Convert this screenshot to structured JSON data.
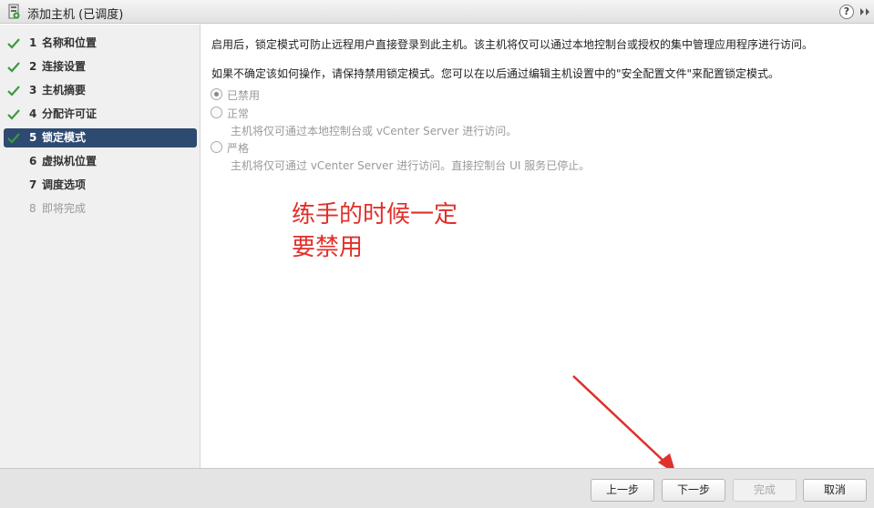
{
  "window": {
    "title": "添加主机 (已调度)",
    "help_label": "?",
    "icons": {
      "title": "host-add-icon",
      "help": "help-icon",
      "expand": "expand-icon"
    }
  },
  "sidebar": {
    "steps": [
      {
        "num": "1",
        "label": "名称和位置",
        "state": "done"
      },
      {
        "num": "2",
        "label": "连接设置",
        "state": "done"
      },
      {
        "num": "3",
        "label": "主机摘要",
        "state": "done"
      },
      {
        "num": "4",
        "label": "分配许可证",
        "state": "done"
      },
      {
        "num": "5",
        "label": "锁定模式",
        "state": "active"
      },
      {
        "num": "6",
        "label": "虚拟机位置",
        "state": "pending"
      },
      {
        "num": "7",
        "label": "调度选项",
        "state": "pending"
      },
      {
        "num": "8",
        "label": "即将完成",
        "state": "disabled"
      }
    ]
  },
  "main": {
    "intro1": "启用后，锁定模式可防止远程用户直接登录到此主机。该主机将仅可以通过本地控制台或授权的集中管理应用程序进行访问。",
    "intro2": "如果不确定该如何操作，请保持禁用锁定模式。您可以在以后通过编辑主机设置中的\"安全配置文件\"来配置锁定模式。",
    "options": [
      {
        "label": "已禁用",
        "selected": true,
        "desc": ""
      },
      {
        "label": "正常",
        "selected": false,
        "desc": "主机将仅可通过本地控制台或 vCenter Server 进行访问。"
      },
      {
        "label": "严格",
        "selected": false,
        "desc": "主机将仅可通过 vCenter Server 进行访问。直接控制台 UI 服务已停止。"
      }
    ]
  },
  "annotation": {
    "line1": "练手的时候一定",
    "line2": "要禁用",
    "color": "#e0302b"
  },
  "footer": {
    "back": "上一步",
    "next": "下一步",
    "finish": "完成",
    "cancel": "取消"
  },
  "colors": {
    "active_step_bg": "#2e4a71",
    "check_green": "#3c9a3c"
  }
}
